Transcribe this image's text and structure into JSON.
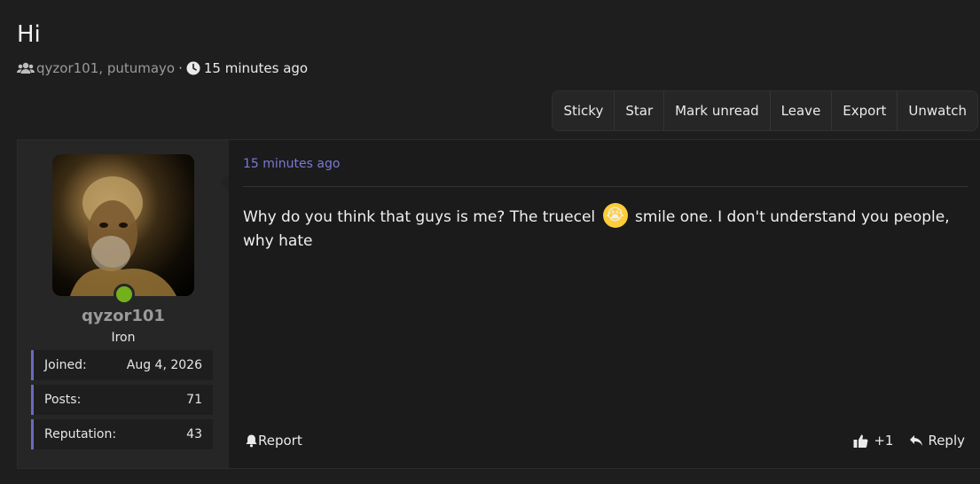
{
  "topic": {
    "title": "Hi",
    "participants": [
      "qyzor101",
      "putumayo"
    ],
    "separator": ",",
    "dot": "·",
    "time": "15 minutes ago"
  },
  "toolbar": {
    "buttons": [
      "Sticky",
      "Star",
      "Mark unread",
      "Leave",
      "Export",
      "Unwatch"
    ]
  },
  "post": {
    "author": {
      "username": "qyzor101",
      "rank": "Iron",
      "online": true,
      "stats": [
        {
          "label": "Joined:",
          "value": "Aug 4, 2026"
        },
        {
          "label": "Posts:",
          "value": "71"
        },
        {
          "label": "Reputation:",
          "value": "43"
        }
      ]
    },
    "date": "15 minutes ago",
    "body_before": "Why do you think that guys is me? The truecel",
    "emoji": "😭",
    "body_after": "smile one. I don't understand you people, why hate",
    "report_label": "Report",
    "reaction_count": "+1",
    "reply_label": "Reply"
  },
  "colors": {
    "accent": "#7a7ad6",
    "online": "#72b01d",
    "background": "#1e1e1e"
  }
}
